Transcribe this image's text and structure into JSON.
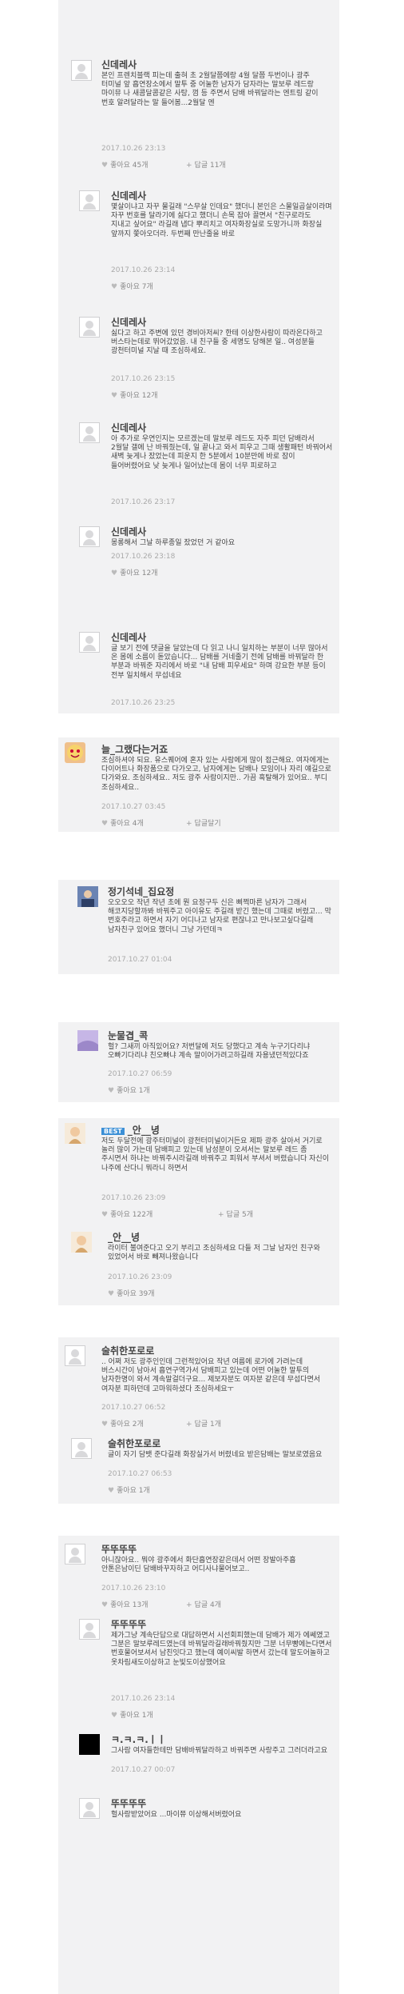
{
  "comments": [
    {
      "nick": "신데레사",
      "text": "본인 프렌치블랙 피는데 출혀 초 2월달쯤에랑 4월 달쯤 두번이나 광주 터미널 앞 흡연장소에서 말투 중 어눌한 남자가 담자라는 말보루 레드랑 마이뮤 나 새콤달콤같은 사탕, 껌 등 주면서 담배 바꿔달라는 엔트링 같이 번호 알려달라는 말 들어봄...2월달 엔",
      "date": "2017.10.26 23:13",
      "likes": "좋아요 45개",
      "replies": "답글 11개"
    },
    {
      "nick": "신데레사",
      "text": "몇살이냐고 자꾸 물길래 \"스무살 인데요\" 했더니 본인은 스물일곱살이라며 자꾸 번호를 달라기에 싫다고 했더니 손목 잡아 끌면서 \"친구로라도 지내고 싶어요\" 라길래 냅다 뿌리치고 여자화장실로 도망가니까 화장실 앞까지 쫓아오더라. 두번째 만난줄을 바로",
      "date": "2017.10.26 23:14",
      "likes": "좋아요 7개"
    },
    {
      "nick": "신데레사",
      "text": "싫다고 하고 주변에 있던 경비아저씨? 한테 이상한사람이 따라온다하고 버스타는데로 뛰어갔었음. 내 친구들 중 세명도 당해본 일.. 여성분들 광천터미널 지날 때 조심하세요.",
      "date": "2017.10.26 23:15",
      "likes": "좋아요 12개"
    },
    {
      "nick": "신데레사",
      "text": "아 추가로 우연인지는 모르겠는데 말보루 레드도 자주 피던 담배라서 2월달 갤에 난 바꿔줬는데, 일 끝나고 와서 피우고 그때 생활패턴 바꿔어서 새벽 늦게나 잤었는데 피운지 한 5분에서 10분만에 바로 잠이 들어버렸어요 낮 늦게나 일어났는데 몸이 너무 피로하고",
      "date": "2017.10.26 23:17"
    },
    {
      "nick": "신데레사",
      "text": "몽롱해서 그날 하루종일 잤었던 거 같아요",
      "date": "2017.10.26 23:18",
      "likes": "좋아요 12개"
    },
    {
      "nick": "신데레사",
      "text": "글 보기 전에 댓글을 달았는데 다 읽고 나니 일치하는 부분이 너무 많아서 온 몸에 소름이 돋았습니다... 담배를 거네줄기 전에 담배를 바꿔달라 한 부분과 바꿔준 자리에서 바로 \"내 담배 피우세요\" 하며 강요한 부분 등이 전부 일치해서 무섭네요",
      "date": "2017.10.26 23:25"
    },
    {
      "nick": "늘_그랬다는거죠",
      "text": "조심하셔야 되요. 유스퀘어에 혼자 있는 사람에게 많이 접근해요. 여자에게는 다이어트나 화장품으로 다가오고, 남자에게는 담배나 모임이나 자리 얘길으로 다가와요. 조심하세요.. 저도 광주 사람이지만.. 가끔 흑탈해가 있어요.. 부디 조심하세요..",
      "date": "2017.10.27 03:45",
      "likes": "좋아요 4개",
      "replies": "답글달기"
    },
    {
      "nick": "정기석네_집요정",
      "text": "오오오오 작년 작년 초에 뭔 요정구두 신은 삐쩍마른 남자가 그래서 해코지당할까봐 바꿔주고 아이유도 주길래 받긴 했는데 그때로 버렸고... 막 번호주라고 하면서 자기 어디나고 남자로 편잖냐고 만나보고싶다길래 남자친구 있어요 했더니 그냥 가던데ㅋ",
      "date": "2017.10.27 01:04"
    },
    {
      "nick": "눈물겹_콕",
      "text": "헐? 그새끼 아직있어요? 저번달에 저도 당했다고 계속 누구기다리냐 오빠기다리냐 친오빠냐 계속 말이어가려고하길래 자용냈던적있다죠",
      "date": "2017.10.27 06:59",
      "likes": "좋아요 1개"
    },
    {
      "nick": "_안__녕",
      "best": "BEST",
      "text": "저도 두달전에 광주터미널이 광천터미널이거든요 제파 광주 살아서 거기로 놀러 많이 가는데 담배피고 있는데 남성분이 오셔서는 말보루 레드 좀 주시면서 하냐는 바꿔주시라길래 바꿔주고 피워서 부셔서 버렸습니다 자신이 나주에 산다니 뭐라니 하면서",
      "date": "2017.10.26 23:09",
      "likes": "좋아요 122개",
      "replies": "답글 5개"
    },
    {
      "nick": "_안__녕",
      "text": "라이터 불여준다고 오기 부리고 조심하세요 다들 저 그날 남자인 친구와 있었어서 바로 빼져나왔습니다",
      "date": "2017.10.26 23:09",
      "likes": "좋아요 39개"
    },
    {
      "nick": "술취한포로로",
      "text": ".. 어쩌 저도 광주인인데 그런적있어요 작년 여름에 로가에 가려는데 버스시간이 남아서 흡연구역가서 담배피고 있는데 어떤 어눌한 말투의 남자한명이 와서 계속말걸더구요... 제보자분도 여자분 같은데 무섭다면서 여자분 피하던데 고마워하셨다 조심하세요ㅜ",
      "date": "2017.10.27 06:52",
      "likes": "좋아요 2개",
      "replies": "답글 1개"
    },
    {
      "nick": "술취한포로로",
      "text": "글이 자기 담뱃 준다길래 화장실가서 버렸네요 받은담배는 말보로였음요",
      "date": "2017.10.27 06:53",
      "likes": "좋아요 1개"
    },
    {
      "nick": "뚜뚜뚜뚜",
      "text": "아니잖아요.. 뭐야 광주에서 화단흡연장같은데서 어떤 장발아주흡 안톤은남이딘 담배바꾸자하고 어디사냐물어보고..",
      "date": "2017.10.26 23:10",
      "likes": "좋아요 13개",
      "replies": "답글 4개"
    },
    {
      "nick": "뚜뚜뚜뚜",
      "text": "제가그냥 계속단답으로 대답하면서 시선회피했는데 담배가 제가 에쎄였고 그분은 말보루레드였는데 바꿔달라길래바꿔줬지만 그분 너무빵에는다면서 번호물어보셔서 남친잇다고 했는데 예이씨발 하면서 갔는데 말도어놀하고 옷차림새도이상하고 눈빛도이상했어요",
      "date": "2017.10.26 23:14",
      "likes": "좋아요 1개"
    },
    {
      "nick": "ㅋ.ㅋ.ㅋ.ㅣㅣ",
      "text": "그사람 여자들한테만 담배바꿔달라하고 바꿔주면 사랑주고 그러더라고요",
      "date": "2017.10.27 00:07"
    },
    {
      "nick": "뚜뚜뚜뚜",
      "text": "헐사랑받았어요 ...마이쮸 이상해서버렸어요"
    }
  ]
}
